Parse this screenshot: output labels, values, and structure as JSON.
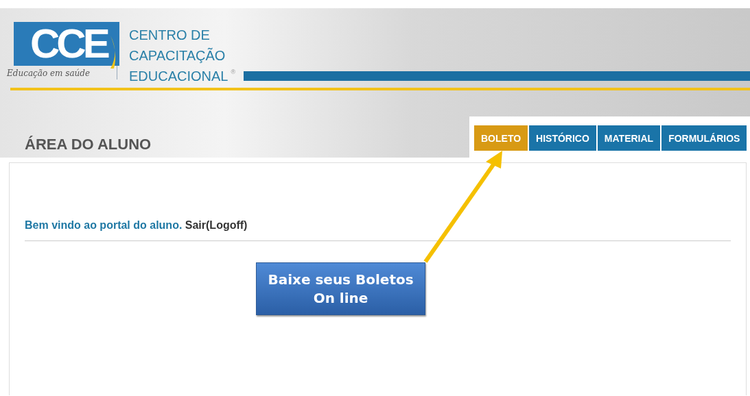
{
  "logo": {
    "mark": "CCE",
    "tagline": "Educação em saúde",
    "name_lines": [
      "CENTRO DE",
      "CAPACITAÇÃO",
      "EDUCACIONAL"
    ],
    "registered": "®"
  },
  "section_title": "ÁREA DO ALUNO",
  "tabs": [
    {
      "label": "BOLETO",
      "selected": true
    },
    {
      "label": "HISTÓRICO",
      "selected": false
    },
    {
      "label": "MATERIAL",
      "selected": false
    },
    {
      "label": "FORMULÁRIOS",
      "selected": false
    }
  ],
  "welcome": {
    "text": "Bem vindo ao portal do aluno.",
    "logoff": "Sair(Logoff)"
  },
  "callout": {
    "lines": [
      "Baixe seus Boletos",
      "On line"
    ]
  }
}
